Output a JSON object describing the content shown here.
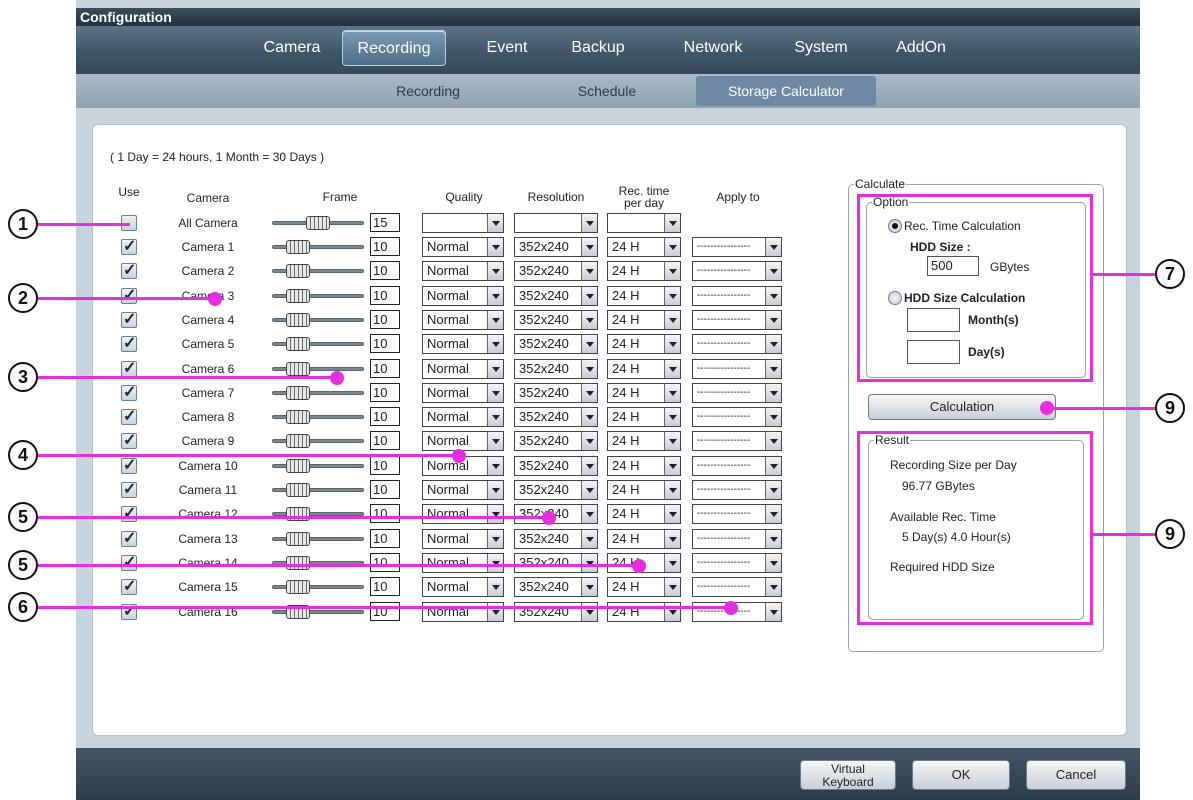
{
  "window": {
    "title": "Configuration"
  },
  "topnav": {
    "tabs": [
      "Camera",
      "Recording",
      "Event",
      "Backup",
      "Network",
      "System",
      "AddOn"
    ],
    "active": "Recording"
  },
  "subnav": {
    "tabs": [
      "Recording",
      "Schedule",
      "Storage Calculator"
    ],
    "active": "Storage Calculator"
  },
  "note": "( 1 Day = 24 hours, 1 Month = 30 Days )",
  "headers": {
    "use": "Use",
    "camera": "Camera",
    "frame": "Frame",
    "quality": "Quality",
    "resolution": "Resolution",
    "rec_time_line1": "Rec. time",
    "rec_time_line2": "per day",
    "apply_to": "Apply to"
  },
  "all_camera": {
    "name": "All Camera",
    "frame": "15",
    "checked": false
  },
  "cameras": [
    {
      "name": "Camera 1",
      "frame": "10",
      "quality": "Normal",
      "resolution": "352x240",
      "rec_time": "24 H",
      "apply": "----------------"
    },
    {
      "name": "Camera 2",
      "frame": "10",
      "quality": "Normal",
      "resolution": "352x240",
      "rec_time": "24 H",
      "apply": "----------------"
    },
    {
      "name": "Camera 3",
      "frame": "10",
      "quality": "Normal",
      "resolution": "352x240",
      "rec_time": "24 H",
      "apply": "----------------"
    },
    {
      "name": "Camera 4",
      "frame": "10",
      "quality": "Normal",
      "resolution": "352x240",
      "rec_time": "24 H",
      "apply": "----------------"
    },
    {
      "name": "Camera 5",
      "frame": "10",
      "quality": "Normal",
      "resolution": "352x240",
      "rec_time": "24 H",
      "apply": "----------------"
    },
    {
      "name": "Camera 6",
      "frame": "10",
      "quality": "Normal",
      "resolution": "352x240",
      "rec_time": "24 H",
      "apply": "----------------"
    },
    {
      "name": "Camera 7",
      "frame": "10",
      "quality": "Normal",
      "resolution": "352x240",
      "rec_time": "24 H",
      "apply": "----------------"
    },
    {
      "name": "Camera 8",
      "frame": "10",
      "quality": "Normal",
      "resolution": "352x240",
      "rec_time": "24 H",
      "apply": "----------------"
    },
    {
      "name": "Camera 9",
      "frame": "10",
      "quality": "Normal",
      "resolution": "352x240",
      "rec_time": "24 H",
      "apply": "----------------"
    },
    {
      "name": "Camera 10",
      "frame": "10",
      "quality": "Normal",
      "resolution": "352x240",
      "rec_time": "24 H",
      "apply": "----------------"
    },
    {
      "name": "Camera 11",
      "frame": "10",
      "quality": "Normal",
      "resolution": "352x240",
      "rec_time": "24 H",
      "apply": "----------------"
    },
    {
      "name": "Camera 12",
      "frame": "10",
      "quality": "Normal",
      "resolution": "352x240",
      "rec_time": "24 H",
      "apply": "----------------"
    },
    {
      "name": "Camera 13",
      "frame": "10",
      "quality": "Normal",
      "resolution": "352x240",
      "rec_time": "24 H",
      "apply": "----------------"
    },
    {
      "name": "Camera 14",
      "frame": "10",
      "quality": "Normal",
      "resolution": "352x240",
      "rec_time": "24 H",
      "apply": "----------------"
    },
    {
      "name": "Camera 15",
      "frame": "10",
      "quality": "Normal",
      "resolution": "352x240",
      "rec_time": "24 H",
      "apply": "----------------"
    },
    {
      "name": "Camera 16",
      "frame": "10",
      "quality": "Normal",
      "resolution": "352x240",
      "rec_time": "24 H",
      "apply": "----------------"
    }
  ],
  "calculate": {
    "legend": "Calculate",
    "option_legend": "Option",
    "rec_time_calc": "Rec. Time Calculation",
    "hdd_size_label": "HDD Size :",
    "hdd_size_value": "500",
    "gbytes": "GBytes",
    "hdd_size_calc": "HDD Size Calculation",
    "months_label": "Month(s)",
    "days_label": "Day(s)",
    "months_value": "",
    "days_value": "",
    "calc_button": "Calculation"
  },
  "result": {
    "legend": "Result",
    "size_per_day_label": "Recording Size per Day",
    "size_per_day_value": "96.77 GBytes",
    "avail_label": "Available Rec. Time",
    "avail_value": "5 Day(s) 4.0 Hour(s)",
    "required_label": "Required HDD Size"
  },
  "buttons": {
    "keyboard_line1": "Virtual",
    "keyboard_line2": "Keyboard",
    "ok": "OK",
    "cancel": "Cancel"
  },
  "callouts": [
    "1",
    "2",
    "3",
    "4",
    "5",
    "5",
    "6",
    "7",
    "9",
    "9"
  ],
  "colors": {
    "highlight": "#e62ee0",
    "nav_dark": "#344a5b",
    "active_tab": "#6e8aa2"
  }
}
